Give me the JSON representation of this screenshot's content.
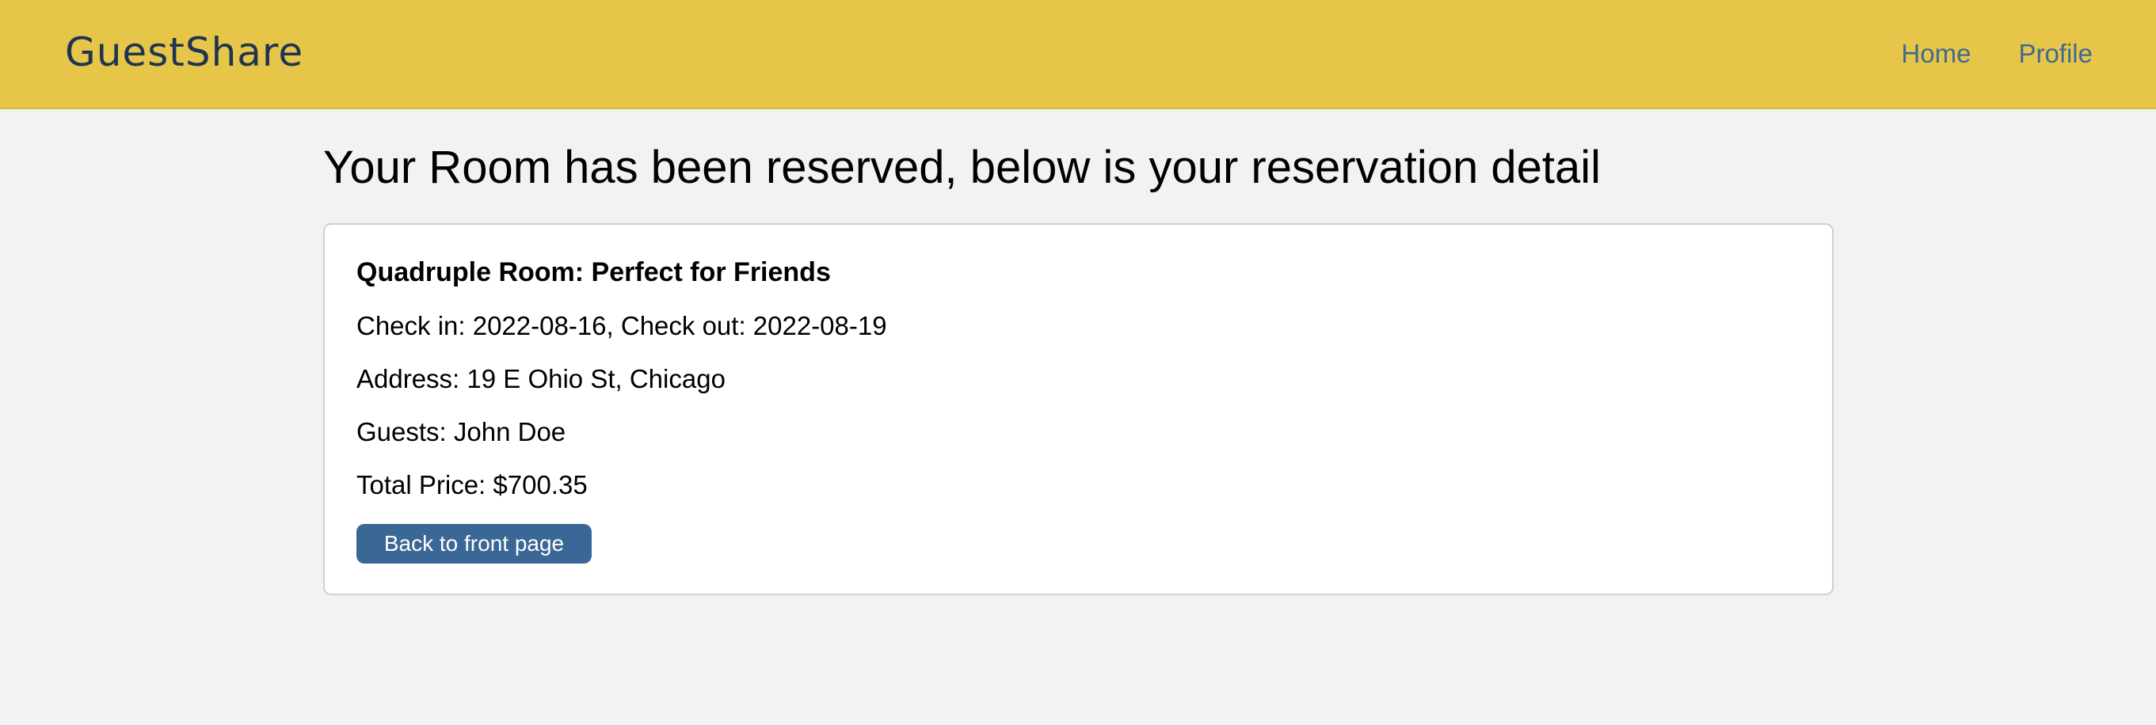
{
  "header": {
    "brand": "GuestShare",
    "nav": [
      {
        "label": "Home"
      },
      {
        "label": "Profile"
      }
    ],
    "accent_color": "#e7c548"
  },
  "main": {
    "heading": "Your Room has been reserved, below is your reservation detail",
    "reservation": {
      "room_title": "Quadruple Room: Perfect for Friends",
      "dates": "Check in: 2022-08-16, Check out: 2022-08-19",
      "address": "Address: 19 E Ohio St, Chicago",
      "guests": "Guests: John Doe",
      "total_price": "Total Price: $700.35",
      "back_button_label": "Back to front page",
      "button_color": "#3b6796"
    }
  }
}
